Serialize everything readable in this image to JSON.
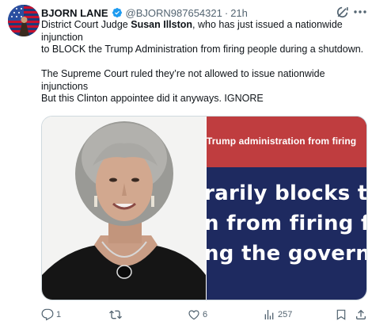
{
  "author": {
    "name": "BJORN LANE",
    "handle": "@BJORN987654321",
    "time": "21h"
  },
  "body": {
    "line1_prefix": "District Court Judge ",
    "line1_bold": "Susan Illston",
    "line1_suffix": ", who has just issued a nationwide",
    "line2": "injunction",
    "line3": "to BLOCK the Trump Administration from firing people during a shutdown.",
    "line4": "The Supreme Court ruled they’re not allowed to issue nationwide",
    "line5": "injunctions",
    "line6": "But this Clinton appointee did it anyways. IGNORE"
  },
  "media": {
    "headline_sub": "Trump administration from firing",
    "headline_line1": "rarily blocks th",
    "headline_line2": "n from firing fe",
    "headline_line3": "ng the governm"
  },
  "actions": {
    "replies": "1",
    "retweets": "",
    "likes": "6",
    "views": "257"
  },
  "colors": {
    "verified": "#1d9bf0",
    "banner_red": "#bf3d3f",
    "banner_navy": "#1e2a60"
  }
}
